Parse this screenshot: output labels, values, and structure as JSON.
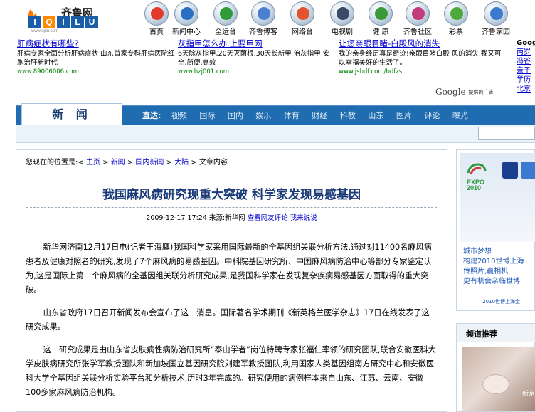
{
  "logo": {
    "cn": "齐鲁网",
    "letters": [
      "I",
      "Q",
      "I",
      "L",
      "U"
    ],
    "url": "www.iqilu.com"
  },
  "topnav": [
    {
      "label": "首页",
      "icon": "home-icon",
      "color": "#e23b2e"
    },
    {
      "label": "新闻中心",
      "icon": "news-icon",
      "color": "#2c6fc2"
    },
    {
      "label": "全运台",
      "icon": "sports-icon",
      "color": "#2f9a3a"
    },
    {
      "label": "齐鲁博客",
      "icon": "blog-icon",
      "color": "#4d7fd0"
    },
    {
      "label": "网络台",
      "icon": "network-icon",
      "color": "#e2542e"
    },
    {
      "label": "电视剧",
      "icon": "tv-icon",
      "color": "#3b4a66"
    },
    {
      "label": "健 康",
      "icon": "health-icon",
      "color": "#3a9a3a"
    },
    {
      "label": "齐鲁社区",
      "icon": "community-icon",
      "color": "#c23b7a"
    },
    {
      "label": "彩票",
      "icon": "lottery-icon",
      "color": "#4caa3a"
    },
    {
      "label": "齐鲁家园",
      "icon": "home-garden-icon",
      "color": "#3b7ad1"
    }
  ],
  "ads": [
    {
      "title": "肝病症状有哪些?",
      "text": "肝病专家全面分析肝病症状 山东首家专科肝病医院细胞治肝新时代",
      "url": "www.89006006.com"
    },
    {
      "title": "灰指甲怎么办,上要甲网",
      "text": "6天除灰指甲,20天灭菌根,30天长新甲 治灰指甲 安全,简便,高效",
      "url": "www.hzj001.com"
    },
    {
      "title": "让您亲眼目睹-白殿风的消失",
      "text": "我的亲身经历真是奇迹!亲眼目睹白殿 风的消失,我又可以幸福美好的生活了。",
      "url": "www.jsbdf.com/bdfzs"
    }
  ],
  "google": {
    "brand": "Google",
    "suffix": "提供的广告"
  },
  "right_ad": {
    "title": "Googl",
    "links": [
      "两岁",
      "冯谷",
      "亲子",
      "学历",
      "北京"
    ]
  },
  "channel": {
    "tab": "新 闻",
    "nav_label": "直达:",
    "nav": [
      "视频",
      "国际",
      "国内",
      "娱乐",
      "体育",
      "财经",
      "科教",
      "山东",
      "图片",
      "评论",
      "曝光"
    ]
  },
  "breadcrumb": {
    "prefix": "您现在的位置是:<",
    "items": [
      "主页",
      "新闻",
      "国内新闻",
      "大陆"
    ],
    "sep": " > ",
    "current": "文章内容"
  },
  "article": {
    "title": "我国麻风病研究现重大突破 科学家发现易感基因",
    "datetime": "2009-12-17 17:24",
    "source": "来源:新华网",
    "link1": "查看网友评论",
    "link2": "我来说说",
    "paragraphs": [
      "新华网济南12月17日电(记者王海鹰)我国科学家采用国际最新的全基因组关联分析方法,通过对11400名麻风病患者及健康对照者的研究,发现了7个麻风病的易感基因。中科院基因研究所、中国麻风病防治中心等部分专家鉴定认为,这是国际上第一个麻风病的全基因组关联分析研究成果,是我国科学家在发现复杂疾病易感基因方面取得的重大突破。",
      "山东省政府17日召开新闻发布会宣布了这一消息。国际著名学术期刊《新英格兰医学杂志》17日在线发表了这一研究成果。",
      "这一研究成果是由山东省皮肤病性病防治研究所“泰山学者”岗位特聘专家张福仁率领的研究团队,联合安徽医科大学皮肤病研究所张学军教授团队和新加坡国立基因研究院刘建军教授团队,利用国家人类基因组南方研究中心和安徽医科大学全基因组关联分析实验平台和分析技术,历时3年完成的。研究使用的病例样本来自山东、江苏、云南、安徽100多家麻风病防治机构。"
    ]
  },
  "expo": {
    "lines": [
      "城市梦想",
      "构建2010世博上海",
      "传照片,赢相机",
      "更有机会亲临世博"
    ],
    "signature": "— 2010世博上海金"
  },
  "recommend": {
    "title": "频道推荐",
    "caption": "新京"
  }
}
